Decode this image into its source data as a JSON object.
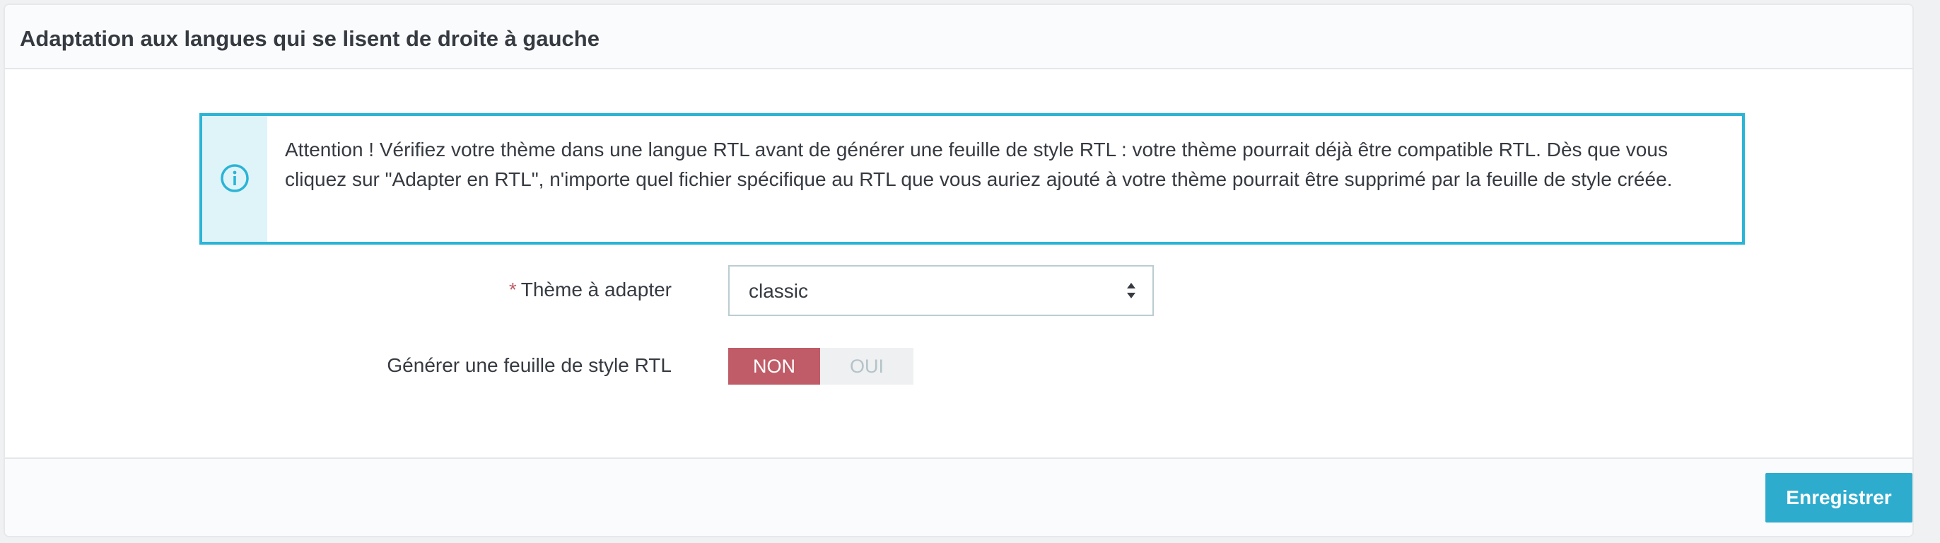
{
  "panel": {
    "title": "Adaptation aux langues qui se lisent de droite à gauche"
  },
  "alert": {
    "icon": "info-circle-icon",
    "text": "Attention ! Vérifiez votre thème dans une langue RTL avant de générer une feuille de style RTL : votre thème pourrait déjà être compatible RTL. Dès que vous cliquez sur \"Adapter en RTL\", n'importe quel fichier spécifique au RTL que vous auriez ajouté à votre thème pourrait être supprimé par la feuille de style créée."
  },
  "form": {
    "theme_label": "Thème à adapter",
    "required_mark": "*",
    "theme_selected": "classic",
    "rtl_label": "Générer une feuille de style RTL",
    "switch_off_label": "NON",
    "switch_on_label": "OUI",
    "switch_value": "NON"
  },
  "footer": {
    "save_label": "Enregistrer"
  },
  "colors": {
    "info_accent": "#2bb4d6",
    "danger": "#c05c67",
    "primary_button": "#2eacce"
  }
}
